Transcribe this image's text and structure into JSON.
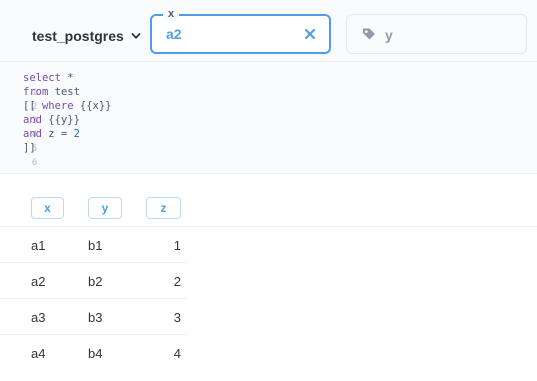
{
  "filters": {
    "database": "test_postgres",
    "param_x": {
      "label": "x",
      "value": "a2"
    },
    "param_y": {
      "placeholder": "y"
    }
  },
  "editor": {
    "lines": [
      {
        "num": "1",
        "text": "select *"
      },
      {
        "num": "2",
        "text": "from test"
      },
      {
        "num": "3",
        "text": "[[ where {{x}}"
      },
      {
        "num": "4",
        "text": "and {{y}}"
      },
      {
        "num": "5",
        "text": "and z = 2"
      },
      {
        "num": "6",
        "text": "]]"
      }
    ]
  },
  "table": {
    "columns": [
      "x",
      "y",
      "z"
    ],
    "rows": [
      [
        "a1",
        "b1",
        "1"
      ],
      [
        "a2",
        "b2",
        "2"
      ],
      [
        "a3",
        "b3",
        "3"
      ],
      [
        "a4",
        "b4",
        "4"
      ]
    ]
  },
  "colors": {
    "accent": "#509ee3",
    "text": "#2e353b",
    "muted": "#949aab"
  },
  "icons": [
    "chevron-down-icon",
    "close-icon",
    "tag-icon"
  ]
}
